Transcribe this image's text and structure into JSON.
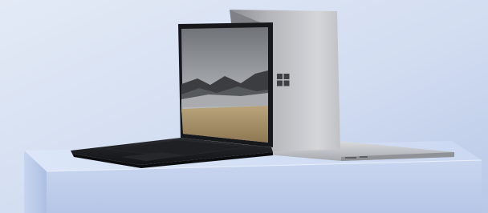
{
  "scene": {
    "subject": "two laptops",
    "laptop_front": {
      "color": "black",
      "state": "open"
    },
    "laptop_back": {
      "color": "silver",
      "state": "open",
      "logo": "windows-logo"
    },
    "colors": {
      "background": "#c9d6ee",
      "pedestal_top": "#d7e2f7",
      "pedestal_front": "#c3d1ec",
      "laptop_dark": "#1b1c1f",
      "laptop_silver": "#b7b9bd"
    }
  }
}
